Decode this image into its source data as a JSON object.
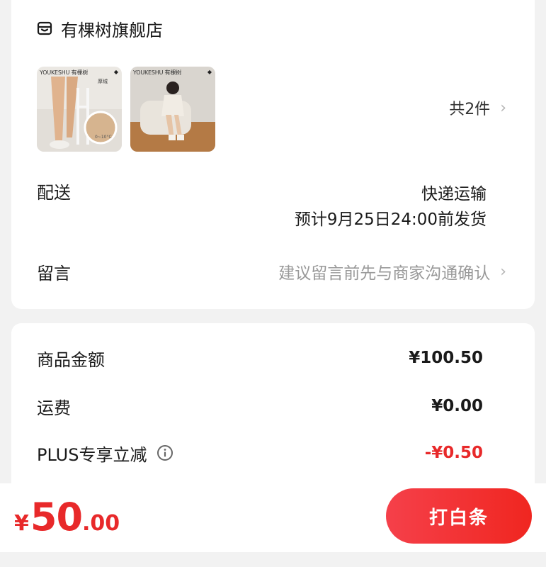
{
  "store": {
    "name": "有棵树旗舰店",
    "icon": "store-icon"
  },
  "products": [
    {
      "brand_text": "YOUKESHU 有棵树",
      "tag": "厚绒",
      "temp": "0~10°C",
      "bg": "#ece9e4"
    },
    {
      "brand_text": "YOUKESHU 有棵树",
      "bg": "#b98a5f"
    }
  ],
  "item_count": "共2件",
  "delivery": {
    "label": "配送",
    "method": "快递运输",
    "eta": "预计9月25日24:00前发货"
  },
  "message": {
    "label": "留言",
    "placeholder": "建议留言前先与商家沟通确认"
  },
  "pricing": {
    "goods_label": "商品金额",
    "goods_value": "¥100.50",
    "shipping_label": "运费",
    "shipping_value": "¥0.00",
    "plus_label": "PLUS专享立减",
    "plus_value": "-¥0.50"
  },
  "footer": {
    "currency": "¥",
    "total_int": "50",
    "total_dec": ".00",
    "pay_label": "打白条"
  },
  "colors": {
    "accent": "#e8292a",
    "background": "#f2f2f2"
  }
}
